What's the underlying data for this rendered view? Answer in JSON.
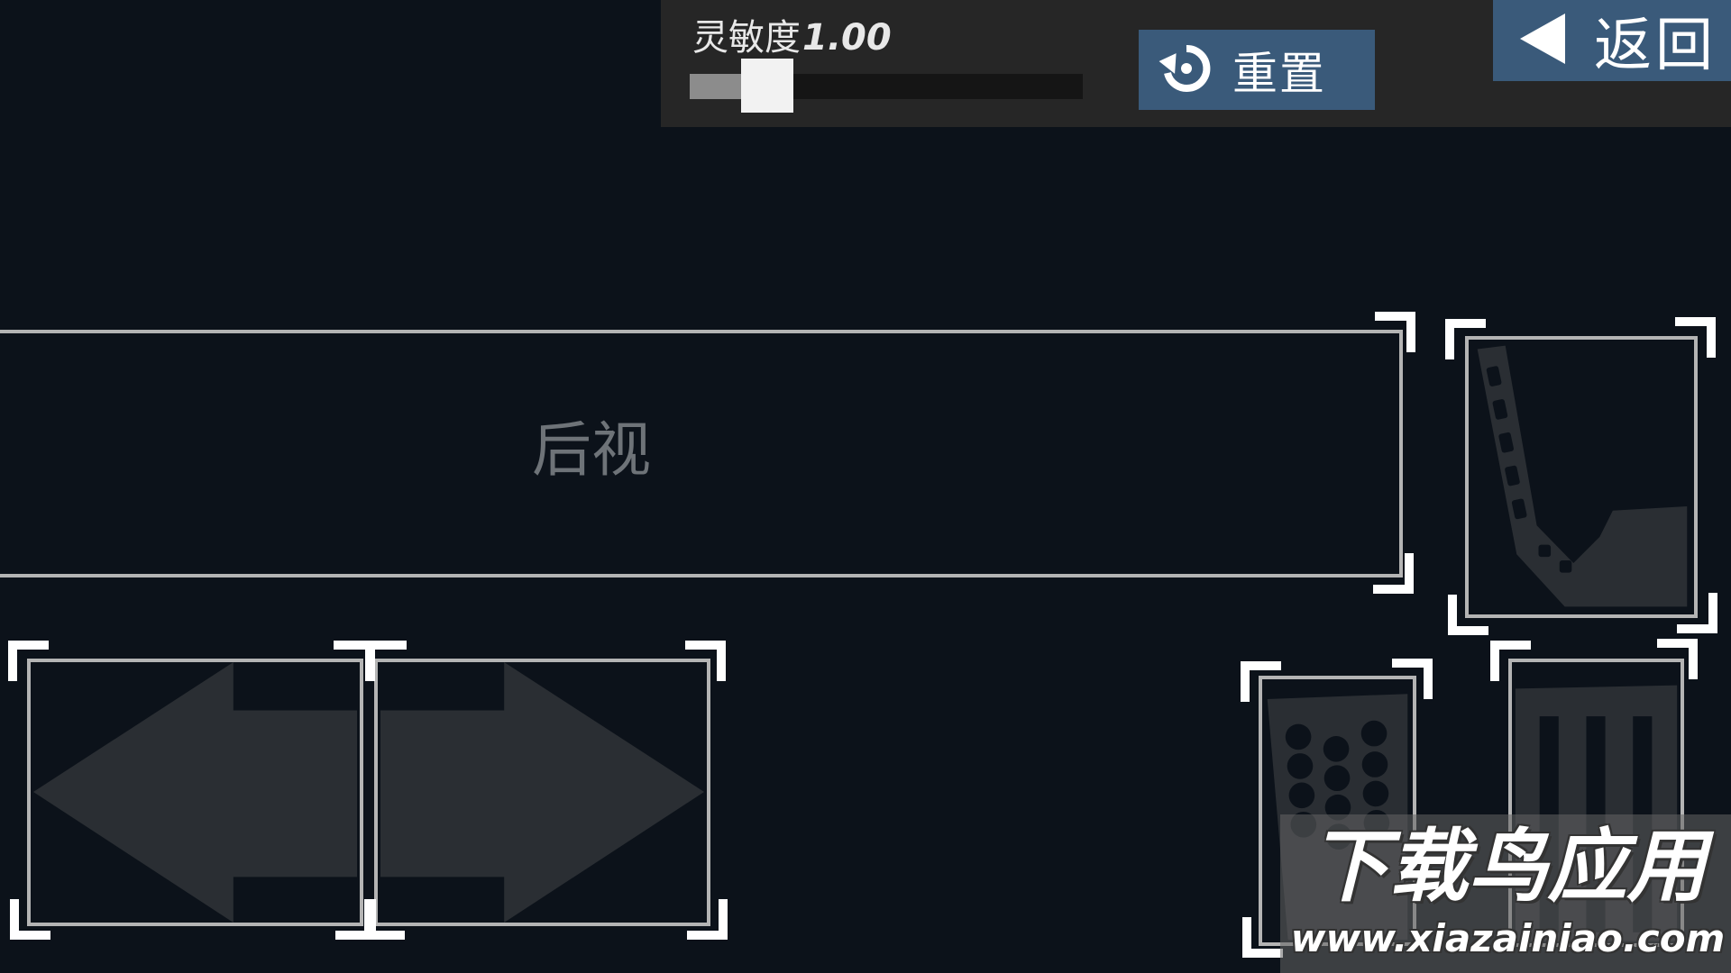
{
  "settings": {
    "sensitivity_label": "灵敏度",
    "sensitivity_value": "1.00",
    "slider_level": 0.13,
    "reset_label": "重置",
    "back_label": "返回"
  },
  "controls": {
    "rear_view_label": "后视"
  },
  "icons": {
    "reset": "reset-icon",
    "back": "triangle-left-icon",
    "steer_left": "arrow-left-icon",
    "steer_right": "arrow-right-icon",
    "clutch": "pedal-clutch-icon",
    "brake": "pedal-brake-icon",
    "throttle": "pedal-throttle-icon"
  },
  "colors": {
    "background": "#0c121a",
    "panel": "#262626",
    "button": "#3a5a7a",
    "frame": "#b4b4b4",
    "icon_fill": "#2a2e33"
  },
  "watermark": {
    "title": "下载鸟应用",
    "url": "www.xiazainiao.com"
  }
}
